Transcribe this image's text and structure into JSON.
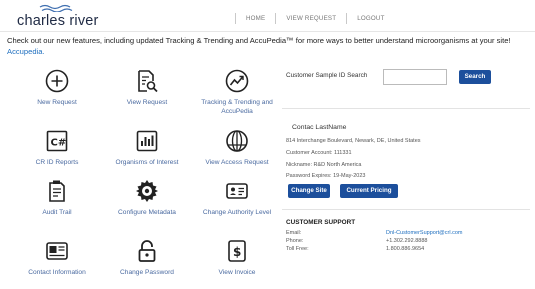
{
  "header": {
    "logo_text": "charles river",
    "nav": [
      "HOME",
      "VIEW REQUEST",
      "LOGOUT"
    ]
  },
  "banner": {
    "text": "Check out our new features, including updated Tracking & Trending and AccuPedia™ for more ways to better understand microorganisms at your site! ",
    "link": "Accupedia."
  },
  "tiles": [
    {
      "label": "New Request",
      "icon": "plus-circle-icon"
    },
    {
      "label": "View Request",
      "icon": "document-search-icon"
    },
    {
      "label": "Tracking & Trending and AccuPedia",
      "icon": "trend-chart-icon"
    },
    {
      "label": "CR ID Reports",
      "icon": "csharp-report-icon"
    },
    {
      "label": "Organisms of Interest",
      "icon": "bar-chart-icon"
    },
    {
      "label": "View Access Request",
      "icon": "access-globe-icon"
    },
    {
      "label": "Audit Trail",
      "icon": "audit-list-icon"
    },
    {
      "label": "Configure Metadata",
      "icon": "gear-icon"
    },
    {
      "label": "Change Authority Level",
      "icon": "id-card-icon"
    },
    {
      "label": "Contact Information",
      "icon": "contact-card-icon"
    },
    {
      "label": "Change Password",
      "icon": "padlock-icon"
    },
    {
      "label": "View Invoice",
      "icon": "dollar-invoice-icon"
    }
  ],
  "search": {
    "label": "Customer Sample ID Search",
    "value": "",
    "button": "Search"
  },
  "contact": {
    "name": "Contac LastName",
    "address": "814 Interchange Boulevard, Newark, DE, United States",
    "account": "Customer Account: 111331",
    "nickname": "Nickname: R&D North America",
    "password_expires": "Password Expires: 19-May-2023",
    "change_site": "Change Site",
    "current_pricing": "Current Pricing"
  },
  "support": {
    "title": "CUSTOMER SUPPORT",
    "email_label": "Email:",
    "email": "Dnl-CustomerSupport@crl.com",
    "phone_label": "Phone:",
    "phone": "+1.302.292.8888",
    "tollfree_label": "Toll Free:",
    "tollfree": "1.800.886.9654"
  },
  "colors": {
    "brand_blue": "#1c4f9c",
    "link_blue": "#1f6fbf",
    "tile_label": "#4a6aa0",
    "icon_stroke": "#222222"
  }
}
